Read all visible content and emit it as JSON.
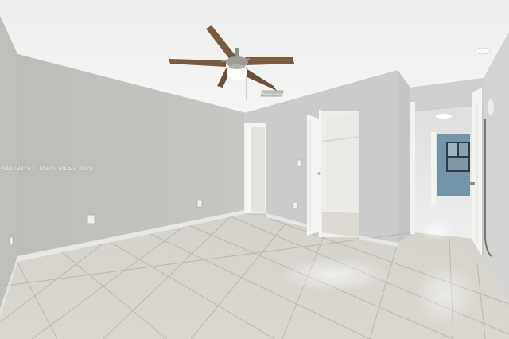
{
  "photo": {
    "watermark": "A1179275 © Miami MLS® 2025"
  },
  "colors": {
    "ceiling": "#f1f1ef",
    "wall_left": "#c3c4c0",
    "wall_back": "#cdcecb",
    "wall_right": "#d2d3d0",
    "floor": "#d9d6ce",
    "grout": "#b9b5ac",
    "baseboard": "#e6e6e3",
    "door_white": "#f4f4f2",
    "fan_blade": "#7a5a3e",
    "blue_wall": "#6f93a8"
  }
}
